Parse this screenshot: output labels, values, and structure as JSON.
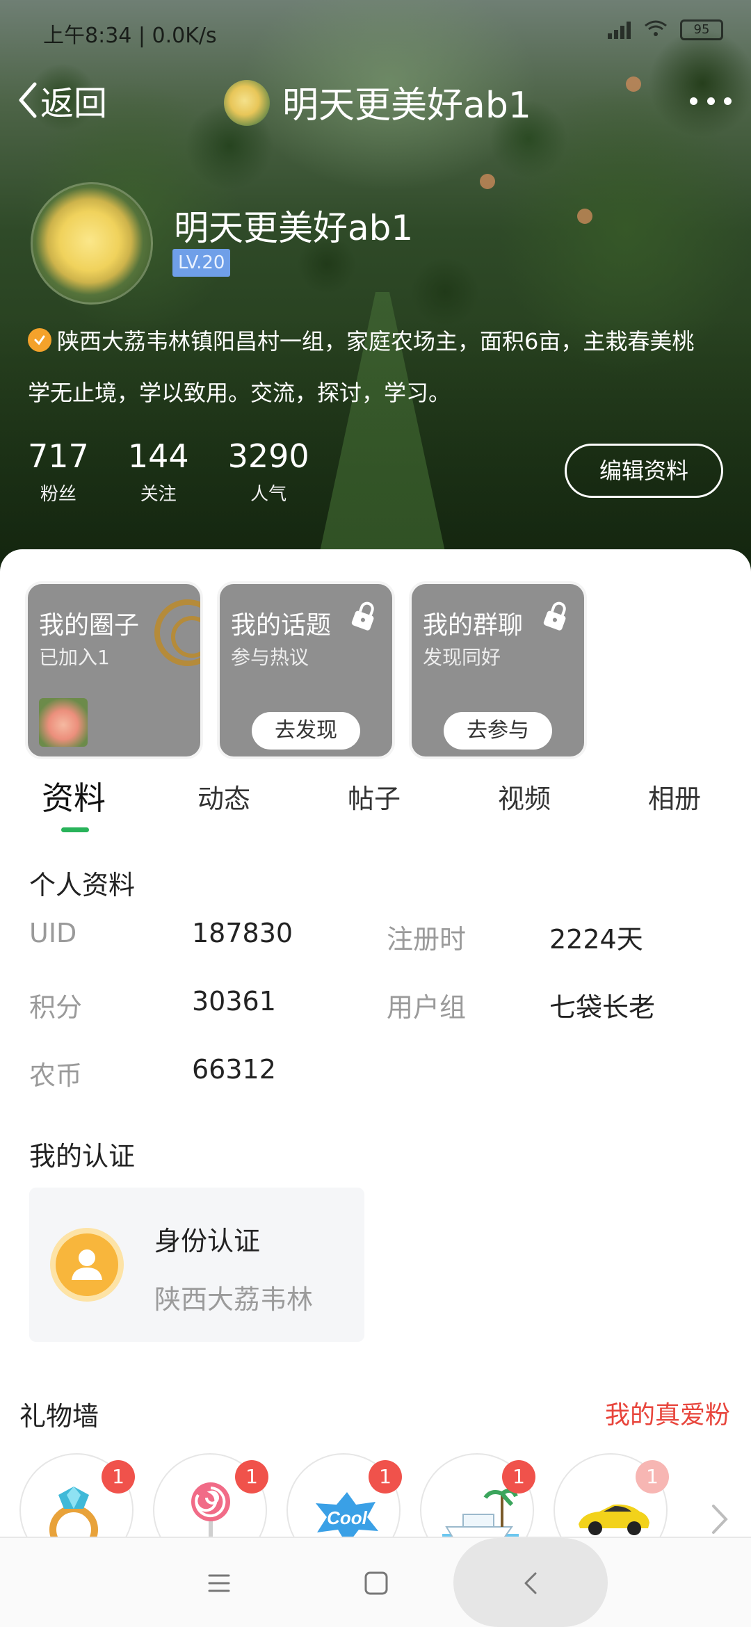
{
  "status_bar": {
    "left_text": "上午8:34 | 0.0K/s",
    "battery": "95"
  },
  "header": {
    "back_label": "返回",
    "title": "明天更美好ab1"
  },
  "profile": {
    "name": "明天更美好ab1",
    "level": "LV.20",
    "bio_line1": "陕西大荔韦林镇阳昌村一组，家庭农场主，面积6亩，主栽春美桃",
    "bio_line2": "学无止境，学以致用。交流，探讨，学习。",
    "stats": [
      {
        "value": "717",
        "label": "粉丝"
      },
      {
        "value": "144",
        "label": "关注"
      },
      {
        "value": "3290",
        "label": "人气"
      }
    ],
    "edit_label": "编辑资料"
  },
  "cards": [
    {
      "title": "我的圈子",
      "subtitle": "已加入1"
    },
    {
      "title": "我的话题",
      "subtitle": "参与热议",
      "button": "去发现"
    },
    {
      "title": "我的群聊",
      "subtitle": "发现同好",
      "button": "去参与"
    }
  ],
  "tabs": [
    "资料",
    "动态",
    "帖子",
    "视频",
    "相册"
  ],
  "personal_info": {
    "title": "个人资料",
    "rows": [
      {
        "k1": "UID",
        "v1": "187830",
        "k2": "注册时",
        "v2": "2224天"
      },
      {
        "k1": "积分",
        "v1": "30361",
        "k2": "用户组",
        "v2": "七袋长老"
      },
      {
        "k1": "农币",
        "v1": "66312"
      }
    ]
  },
  "certification": {
    "title": "我的认证",
    "card_title": "身份认证",
    "card_sub": "陕西大荔韦林"
  },
  "gift_wall": {
    "title": "礼物墙",
    "link": "我的真爱粉",
    "gifts": [
      {
        "icon": "ring-icon",
        "count": "1"
      },
      {
        "icon": "lollipop-icon",
        "count": "1"
      },
      {
        "icon": "cool-sticker-icon",
        "count": "1"
      },
      {
        "icon": "yacht-icon",
        "count": "1"
      },
      {
        "icon": "sports-car-icon",
        "count": "1"
      }
    ]
  },
  "colors": {
    "accent_green": "#28b35a",
    "link_red": "#e8453c",
    "level_blue": "#6f9fe8",
    "verify_orange": "#f4a22b"
  }
}
